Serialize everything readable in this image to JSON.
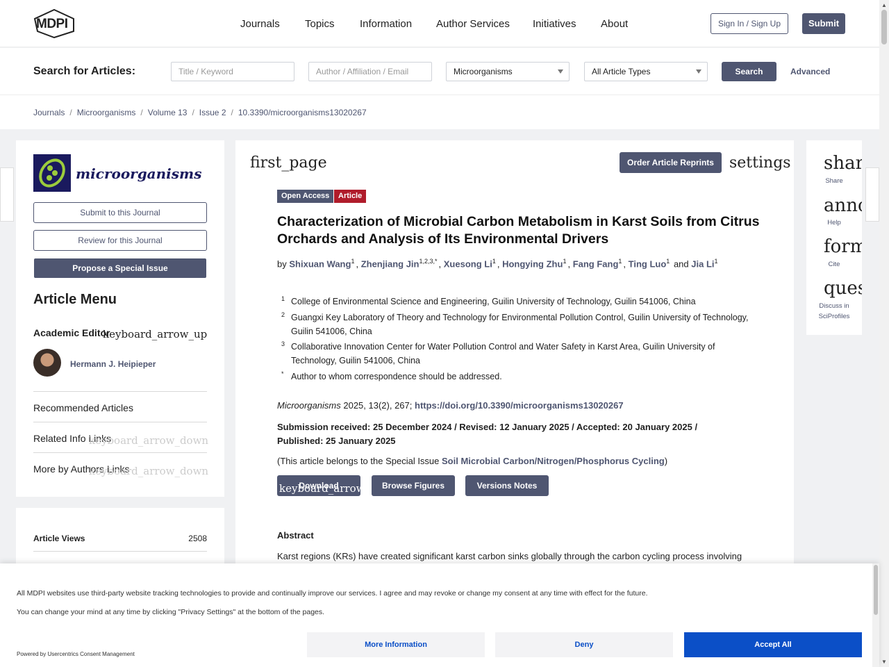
{
  "header": {
    "logo_text": "MDPI",
    "nav": [
      "Journals",
      "Topics",
      "Information",
      "Author Services",
      "Initiatives",
      "About"
    ],
    "signin_label": "Sign In / Sign Up",
    "submit_label": "Submit"
  },
  "search": {
    "label": "Search for Articles:",
    "title_placeholder": "Title / Keyword",
    "author_placeholder": "Author / Affiliation / Email",
    "journal_value": "Microorganisms",
    "type_value": "All Article Types",
    "button_label": "Search",
    "advanced_label": "Advanced"
  },
  "breadcrumb": [
    "Journals",
    "Microorganisms",
    "Volume 13",
    "Issue 2",
    "10.3390/microorganisms13020267"
  ],
  "sidebar": {
    "journal_name": "microorganisms",
    "submit_label": "Submit to this Journal",
    "review_label": "Review for this Journal",
    "propose_label": "Propose a Special Issue",
    "menu_title": "Article Menu",
    "academic_editor_label": "Academic Editor",
    "arrow_up_icon": "keyboard_arrow_up",
    "arrow_down_icon": "keyboard_arrow_down",
    "editor_name": "Hermann J. Heipieper",
    "items": [
      {
        "label": "Recommended Articles"
      },
      {
        "label": "Related Info Links"
      },
      {
        "label": "More by Authors Links"
      }
    ],
    "views_label": "Article Views",
    "views_value": "2508"
  },
  "article": {
    "first_page_icon": "first_page",
    "reprints_label": "Order Article Reprints",
    "settings_icon": "settings",
    "badge_open": "Open Access",
    "badge_type": "Article",
    "title": "Characterization of Microbial Carbon Metabolism in Karst Soils from Citrus Orchards and Analysis of Its Environmental Drivers",
    "by": "by",
    "authors": [
      {
        "name": "Shixuan Wang",
        "sup": "1"
      },
      {
        "name": "Zhenjiang Jin",
        "sup": "1,2,3,*"
      },
      {
        "name": "Xuesong Li",
        "sup": "1"
      },
      {
        "name": "Hongying Zhu",
        "sup": "1"
      },
      {
        "name": "Fang Fang",
        "sup": "1"
      },
      {
        "name": "Ting Luo",
        "sup": "1"
      },
      {
        "name": "Jia Li",
        "sup": "1"
      }
    ],
    "and": "and",
    "orcid_glyph": "",
    "affiliations": [
      {
        "n": "1",
        "text": "College of Environmental Science and Engineering, Guilin University of Technology, Guilin 541006, China"
      },
      {
        "n": "2",
        "text": "Guangxi Key Laboratory of Theory and Technology for Environmental Pollution Control, Guilin University of Technology, Guilin 541006, China"
      },
      {
        "n": "3",
        "text": "Collaborative Innovation Center for Water Pollution Control and Water Safety in Karst Area, Guilin University of Technology, Guilin 541006, China"
      },
      {
        "n": "*",
        "text": "Author to whom correspondence should be addressed."
      }
    ],
    "journal": "Microorganisms",
    "citation_rest": " 2025, 13(2), 267; ",
    "doi": "https://doi.org/10.3390/microorganisms13020267",
    "dates": "Submission received: 25 December 2024 / Revised: 12 January 2025 / Accepted: 20 January 2025 / Published: 25 January 2025",
    "special_prefix": "(This article belongs to the Special Issue ",
    "special_link": "Soil Microbial Carbon/Nitrogen/Phosphorus Cycling",
    "special_suffix": ")",
    "download_label": "Download",
    "download_icon": "keyboard_arrow_down",
    "figures_label": "Browse Figures",
    "versions_label": "Versions Notes",
    "abstract_heading": "Abstract",
    "abstract_text": "Karst regions (KRs) have created significant karst carbon sinks globally through the carbon cycling process involving"
  },
  "right_tools": [
    {
      "icon": "share",
      "label": "Share"
    },
    {
      "icon": "announcement",
      "label": "Help"
    },
    {
      "icon": "format_quote",
      "label": "Cite"
    },
    {
      "icon": "question_answer",
      "label": "Discuss in SciProfiles"
    }
  ],
  "edge_tab_glyph": "",
  "cookie": {
    "line1": "All MDPI websites use third-party website tracking technologies to provide and continually improve our services. I agree and may revoke or change my consent at any time with effect for the future.",
    "line2": "You can change your mind at any time by clicking \"Privacy Settings\" at the bottom of the pages.",
    "powered": "Powered by Usercentrics Consent Management",
    "more_label": "More Information",
    "deny_label": "Deny",
    "accept_label": "Accept All"
  },
  "colors": {
    "brand": "#4f5671",
    "accept": "#0b4fc7",
    "open_access": "#4f5671",
    "article_badge": "#b01c2b"
  }
}
